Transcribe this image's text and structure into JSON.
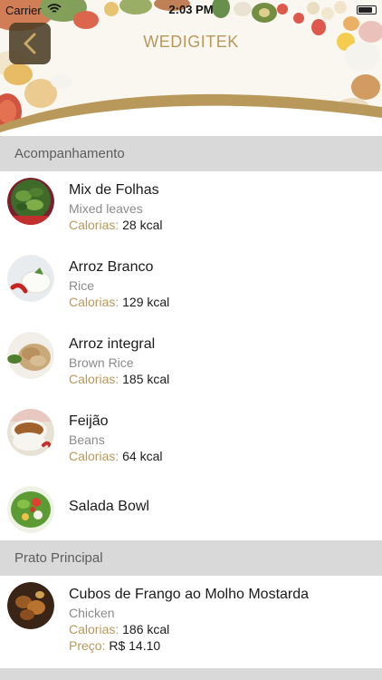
{
  "status_bar": {
    "carrier": "Carrier",
    "time": "2:03 PM",
    "battery_level": 0.85
  },
  "header": {
    "title": "WEDIGITEK",
    "back_icon": "chevron-left-icon"
  },
  "colors": {
    "accent_gold": "#b9985b",
    "section_bg": "#d9d9d9",
    "back_button_bg": "#4b3e26"
  },
  "sections": [
    {
      "title": "Acompanhamento",
      "items": [
        {
          "name": "Mix de Folhas",
          "subtitle": "Mixed leaves",
          "calorias_label": "Calorias:",
          "calorias": "28 kcal"
        },
        {
          "name": "Arroz Branco",
          "subtitle": "Rice",
          "calorias_label": "Calorias:",
          "calorias": "129 kcal"
        },
        {
          "name": "Arroz integral",
          "subtitle": "Brown Rice",
          "calorias_label": "Calorias:",
          "calorias": "185 kcal"
        },
        {
          "name": "Feijão",
          "subtitle": "Beans",
          "calorias_label": "Calorias:",
          "calorias": "64 kcal"
        },
        {
          "name": "Salada Bowl"
        }
      ]
    },
    {
      "title": "Prato Principal",
      "items": [
        {
          "name": "Cubos de Frango ao Molho Mostarda",
          "subtitle": "Chicken",
          "calorias_label": "Calorias:",
          "calorias": "186 kcal",
          "preco_label": "Preço:",
          "preco": "R$ 14.10"
        }
      ]
    }
  ]
}
